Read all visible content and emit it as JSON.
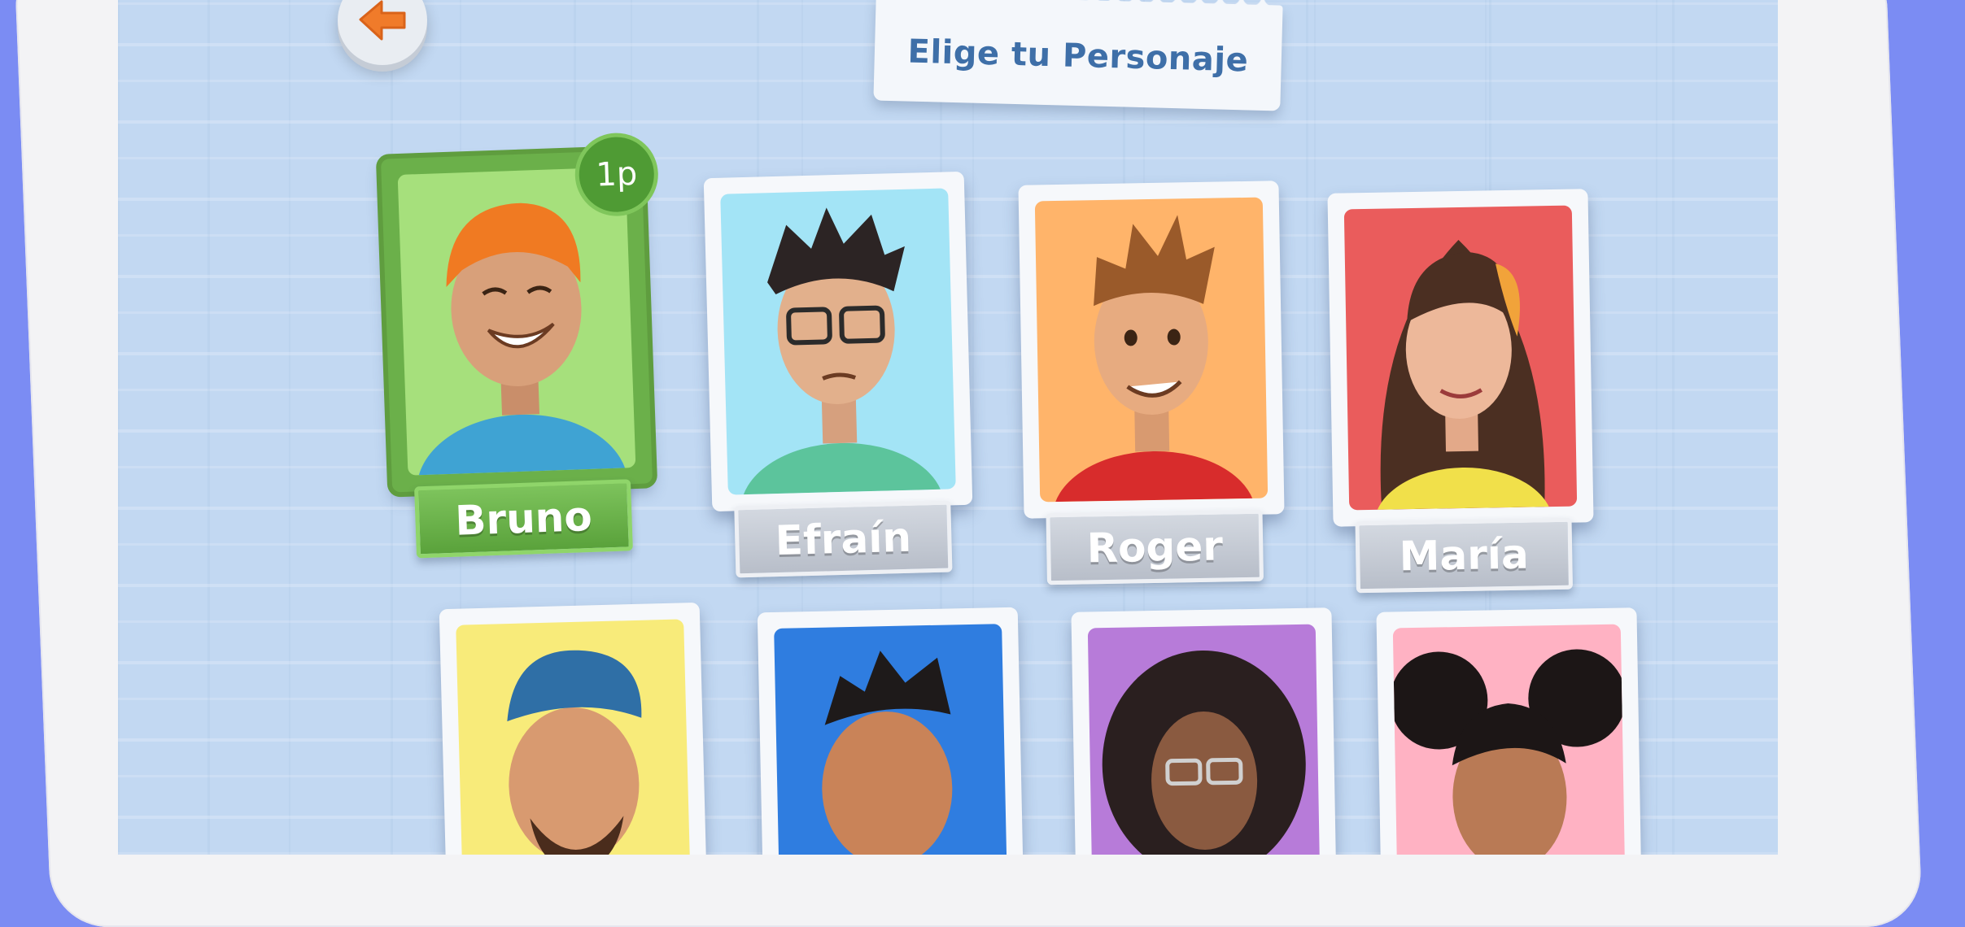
{
  "header": {
    "title": "Elige tu Personaje"
  },
  "navigation": {
    "back_icon": "back-arrow-icon"
  },
  "colors": {
    "background": "#7b8cf3",
    "screen": "#c2d8f2",
    "title": "#3e6fa8",
    "selected": "#6bb04a",
    "back_arrow": "#f07b2a"
  },
  "selection": {
    "player_badge": "1p"
  },
  "characters": [
    {
      "name": "Bruno",
      "bg": "#a6e07c",
      "selected": true
    },
    {
      "name": "Efraín",
      "bg": "#a3e4f6",
      "selected": false
    },
    {
      "name": "Roger",
      "bg": "#ffb46a",
      "selected": false
    },
    {
      "name": "María",
      "bg": "#ea5c5c",
      "selected": false
    },
    {
      "name": "",
      "bg": "#f8eb7a",
      "selected": false
    },
    {
      "name": "",
      "bg": "#2f7de0",
      "selected": false
    },
    {
      "name": "",
      "bg": "#b77bd9",
      "selected": false
    },
    {
      "name": "",
      "bg": "#ffb2c3",
      "selected": false
    }
  ]
}
